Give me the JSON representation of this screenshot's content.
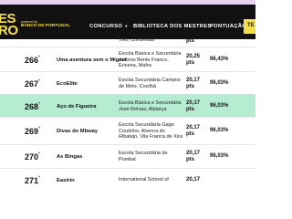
{
  "nav": {
    "logo_line1": "ES",
    "logo_line2": "RO",
    "powered_by": "powered by",
    "sponsor": "BANCO DE PORTUGAL",
    "links": [
      "CONCURSO",
      "BIBLIOTECA DOS MESTRES",
      "PONTUAÇÃO"
    ],
    "button_label": "TE"
  },
  "rows": [
    {
      "rank": "",
      "suffix": "",
      "title": "",
      "school": [
        "Tolo, Condeixas"
      ],
      "pts": "pts",
      "pct": ""
    },
    {
      "rank": "266",
      "suffix": "º",
      "title": "Uma aventura sem o Miguel",
      "school": [
        "Escola Básica e Secundária",
        "Antonio Bento Franco,",
        "Ericeira, Mafra"
      ],
      "pts": "20,25",
      "pts_unit": "pts",
      "pct": "96,43%"
    },
    {
      "rank": "267",
      "suffix": "º",
      "title": "EcoElite",
      "school": [
        "Escola Secundária Campos",
        "de Melo, Covilhã"
      ],
      "pts": "20,17",
      "pts_unit": "pts",
      "pct": "96,03%"
    },
    {
      "rank": "268",
      "suffix": "º",
      "title": "Aço de Figueira",
      "school": [
        "Escola Básica e Secundária",
        "José Relvas, Alpiarça"
      ],
      "pts": "20,17",
      "pts_unit": "pts",
      "pct": "96,03%"
    },
    {
      "rank": "269",
      "suffix": "º",
      "title": "Divas do Mbway",
      "school": [
        "Escola Secundária Gago",
        "Coutinho, Alverca do",
        "Ribatejo, Vila Franca de Xira"
      ],
      "pts": "20,17",
      "pts_unit": "pts",
      "pct": "96,03%"
    },
    {
      "rank": "270",
      "suffix": "º",
      "title": "As Bingas",
      "school": [
        "Escola Secundária de",
        "Pombal"
      ],
      "pts": "20,17",
      "pts_unit": "pts",
      "pct": "96,03%"
    },
    {
      "rank": "271",
      "suffix": "º",
      "title": "Eastrin",
      "school": [
        "International School of"
      ],
      "pts": "20,17",
      "pts_unit": "",
      "pct": ""
    }
  ],
  "colors": {
    "nav_bg": "#111111",
    "accent_yellow": "#f5e04a",
    "highlight_row": "#b5ecd2",
    "top_strip": "#e9d2f2"
  }
}
